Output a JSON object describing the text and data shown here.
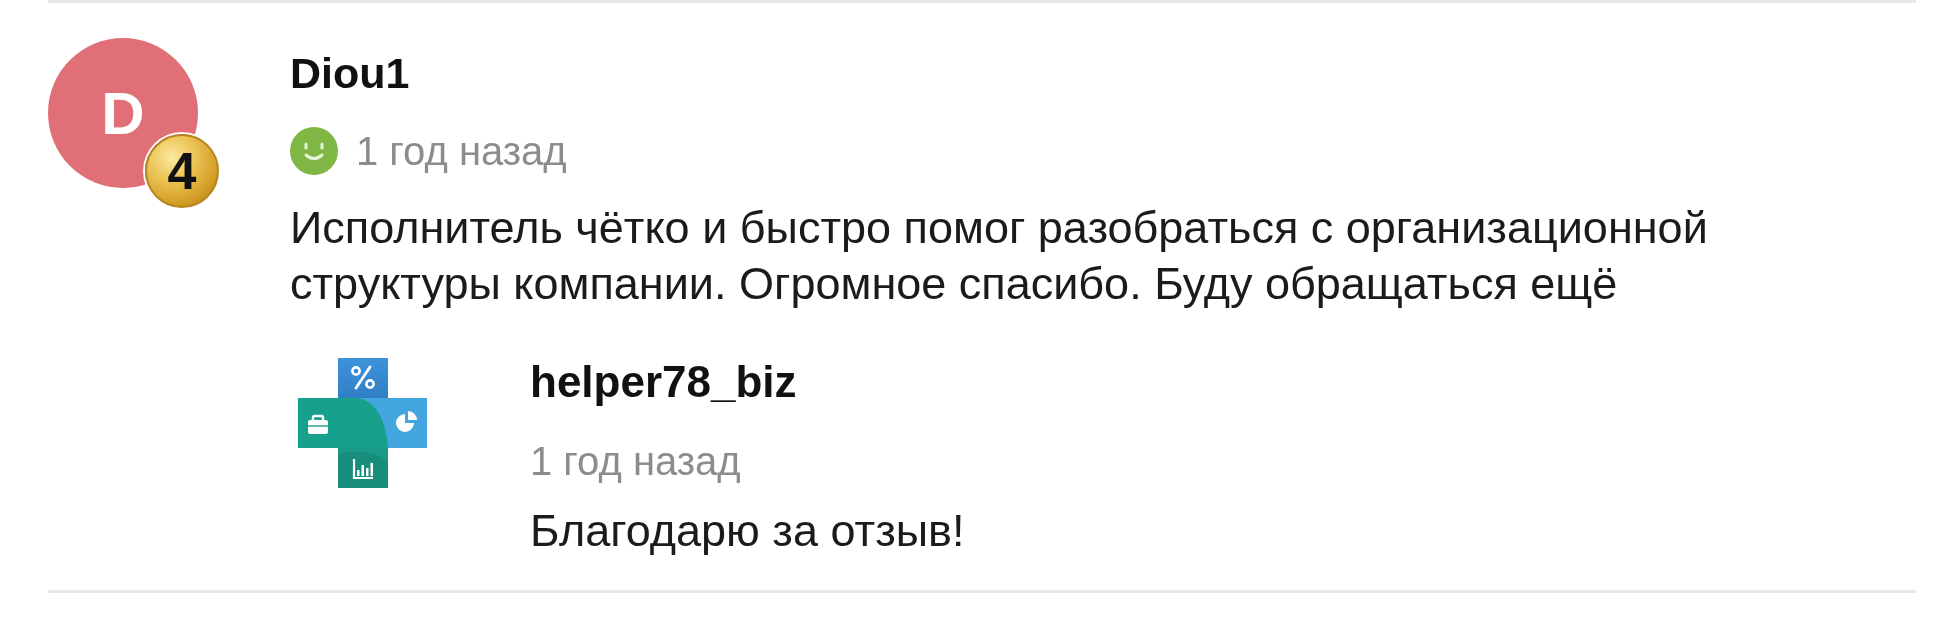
{
  "review": {
    "avatar": {
      "letter": "D",
      "badge": "4"
    },
    "author": "Diou1",
    "satisfied": true,
    "time": "1 год назад",
    "text": "Исполнитель чётко и быстро помог разобраться с организационной структуры компании. Огромное спасибо. Буду обращаться ещё",
    "reply": {
      "author": "helper78_biz",
      "time": "1 год назад",
      "text": "Благодарю за отзыв!"
    }
  }
}
